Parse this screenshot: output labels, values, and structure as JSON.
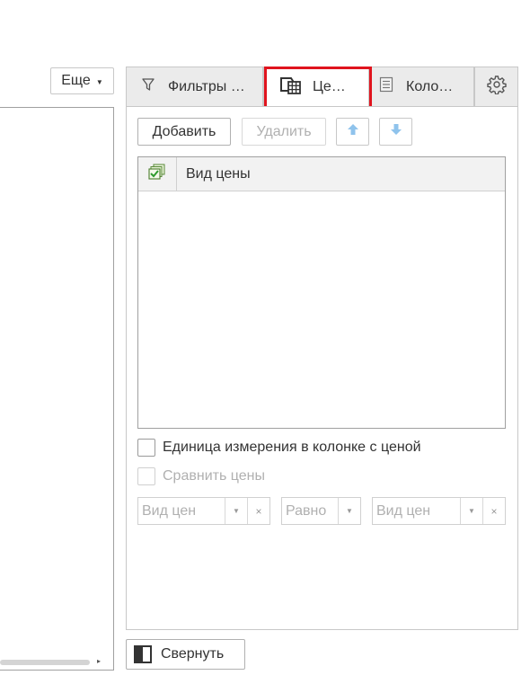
{
  "toolbar": {
    "more_label": "Еще"
  },
  "tabs": [
    {
      "label": "Фильтры …",
      "icon": "filter-icon"
    },
    {
      "label": "Це…",
      "icon": "price-calculator-icon",
      "active": true
    },
    {
      "label": "Коло…",
      "icon": "columns-list-icon"
    },
    {
      "label": "",
      "icon": "gear-icon"
    }
  ],
  "actions": {
    "add_label": "Добавить",
    "delete_label": "Удалить",
    "up_icon": "arrow-up-icon",
    "down_icon": "arrow-down-icon"
  },
  "table": {
    "column_header": "Вид цены",
    "rows": []
  },
  "options": {
    "unit_in_price_column": {
      "label": "Единица измерения в колонке с ценой",
      "checked": false
    },
    "compare_prices": {
      "label": "Сравнить цены",
      "checked": false,
      "disabled": true
    }
  },
  "compare": {
    "price_type_1_placeholder": "Вид цен",
    "condition_value": "Равно",
    "price_type_2_placeholder": "Вид цен",
    "clear_symbol": "×"
  },
  "footer": {
    "collapse_label": "Свернуть"
  },
  "colors": {
    "highlight": "#e0141e",
    "arrow": "#7cb8e8"
  }
}
